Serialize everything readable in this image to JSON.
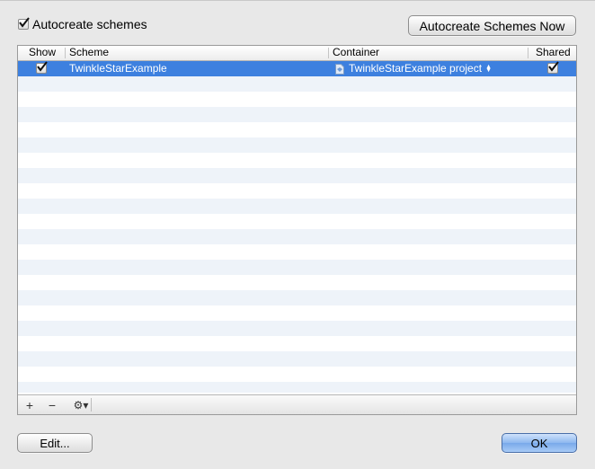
{
  "window": {
    "autocreate_label": "Autocreate schemes",
    "autocreate_checked": true,
    "autocreate_now_label": "Autocreate Schemes Now"
  },
  "table": {
    "columns": {
      "show": "Show",
      "scheme": "Scheme",
      "container": "Container",
      "shared": "Shared"
    },
    "rows": [
      {
        "show": true,
        "scheme": "TwinkleStarExample",
        "container": "TwinkleStarExample project",
        "shared": true,
        "selected": true
      }
    ]
  },
  "toolbar": {
    "add_glyph": "+",
    "remove_glyph": "−",
    "action_glyph": "⚙▾"
  },
  "footer": {
    "edit_label": "Edit...",
    "ok_label": "OK"
  },
  "colors": {
    "selection": "#3d80df",
    "alt_row": "#eef3f9",
    "ok_button": "#8db8ef"
  },
  "icons": {
    "container": "project-document-icon",
    "popup": "popup-arrows-icon",
    "action": "gear-icon"
  }
}
